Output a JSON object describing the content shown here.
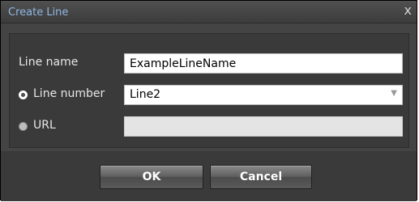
{
  "dialog": {
    "title": "Create Line",
    "close_glyph": "x"
  },
  "form": {
    "line_name_label": "Line name",
    "line_name_value": "ExampleLineName",
    "line_number_label": "Line number",
    "line_number_value": "Line2",
    "url_label": "URL",
    "url_value": "",
    "selected_option": "line_number"
  },
  "buttons": {
    "ok": "OK",
    "cancel": "Cancel"
  },
  "icons": {
    "close": "close-icon",
    "dropdown": "chevron-down-icon"
  }
}
